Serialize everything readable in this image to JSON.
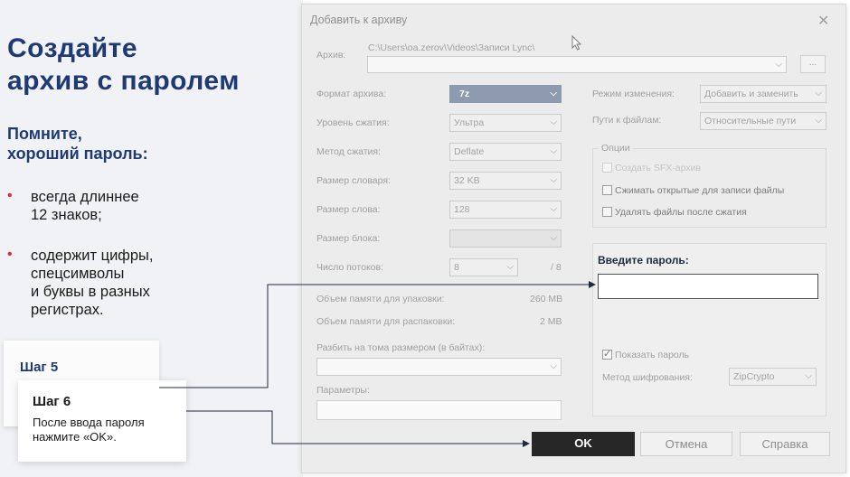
{
  "slide": {
    "title_line1": "Создайте",
    "title_line2": "архив с паролем",
    "subtitle_line1": "Помните,",
    "subtitle_line2": "хороший пароль:",
    "bullets": [
      {
        "marker": "•",
        "text": "всегда длиннее\n12 знаков;"
      },
      {
        "marker": "•",
        "text": "содержит цифры,\nспецсимволы\nи буквы в разных\nрегистрах."
      }
    ],
    "step5_label": "Шаг 5",
    "step6_label": "Шаг 6",
    "step6_desc": "После ввода пароля нажмите «OK».",
    "accent_color": "#1f3a73",
    "bullet_color": "#e2263a"
  },
  "dialog": {
    "title": "Добавить к архиву",
    "close_glyph": "✕",
    "archive_label": "Архив:",
    "archive_path": "C:\\Users\\oa.zerov\\Videos\\Записи Lync\\",
    "archive_name": "",
    "browse_label": "...",
    "left_rows": [
      {
        "label": "Формат архива:",
        "value": "7z"
      },
      {
        "label": "Уровень сжатия:",
        "value": "Ультра"
      },
      {
        "label": "Метод сжатия:",
        "value": "Deflate"
      },
      {
        "label": "Размер словаря:",
        "value": "32 KB"
      },
      {
        "label": "Размер слова:",
        "value": "128"
      },
      {
        "label": "Размер блока:",
        "value": ""
      },
      {
        "label": "Число потоков:",
        "value": "8"
      }
    ],
    "threads_total": "/ 8",
    "memory_pack_label": "Объем памяти для упаковки:",
    "memory_pack_value": "260 MB",
    "memory_unpack_label": "Объем памяти для распаковки:",
    "memory_unpack_value": "2 MB",
    "split_label": "Разбить на тома размером (в байтах):",
    "split_value": "",
    "params_label": "Параметры:",
    "params_value": "",
    "update_mode_label": "Режим изменения:",
    "update_mode_value": "Добавить и заменить",
    "path_mode_label": "Пути к файлам:",
    "path_mode_value": "Относительные пути",
    "options_title": "Опции",
    "options": [
      {
        "label": "Создать SFX-архив",
        "checked": false,
        "disabled": true
      },
      {
        "label": "Сжимать открытые для записи файлы",
        "checked": false,
        "disabled": false
      },
      {
        "label": "Удалять файлы после сжатия",
        "checked": false,
        "disabled": false
      }
    ],
    "password_title": "Введите пароль:",
    "password_value": "",
    "show_password_label": "Показать пароль",
    "show_password_checked": true,
    "encryption_label": "Метод шифрования:",
    "encryption_value": "ZipCrypto",
    "ok_label": "OK",
    "cancel_label": "Отмена",
    "help_label": "Справка"
  }
}
